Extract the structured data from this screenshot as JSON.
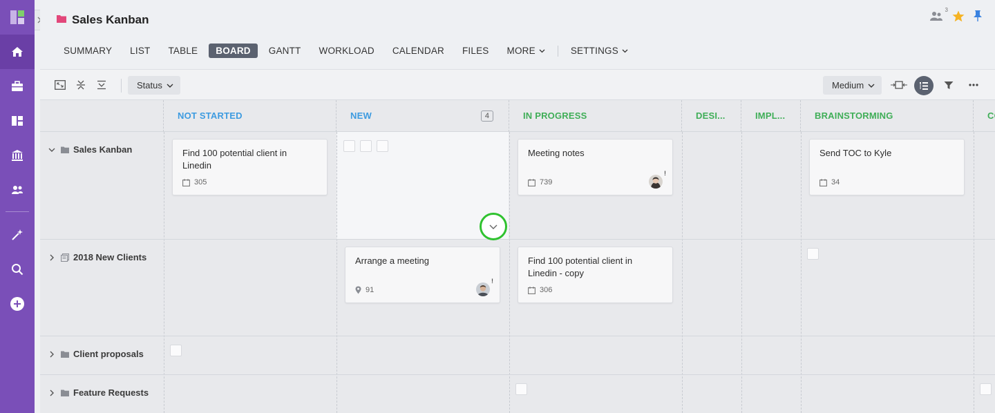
{
  "app": {
    "title": "Sales Kanban",
    "header_icons": [
      "people-icon",
      "star-icon",
      "pin-icon"
    ],
    "member_count": "3",
    "accent": "#7a4fb8",
    "star_color": "#f5b324",
    "pin_color": "#3a82e0"
  },
  "sidebar": {
    "items": [
      "logo-icon",
      "home-icon",
      "briefcase-icon",
      "dashboard-icon",
      "bank-icon",
      "people-icon",
      "magic-wand-icon",
      "search-icon",
      "add-icon"
    ]
  },
  "tabs": [
    {
      "label": "SUMMARY"
    },
    {
      "label": "LIST"
    },
    {
      "label": "TABLE"
    },
    {
      "label": "BOARD",
      "active": true
    },
    {
      "label": "GANTT"
    },
    {
      "label": "WORKLOAD"
    },
    {
      "label": "CALENDAR"
    },
    {
      "label": "FILES"
    },
    {
      "label": "MORE"
    },
    {
      "label": "SETTINGS"
    }
  ],
  "toolbar": {
    "group_by": "Status",
    "card_size": "Medium"
  },
  "columns": [
    {
      "label": "NOT STARTED",
      "color": "#3d9be0"
    },
    {
      "label": "NEW",
      "count": "4",
      "color": "#3d9be0"
    },
    {
      "label": "IN PROGRESS",
      "color": "#3fae57"
    },
    {
      "label": "DESI...",
      "color": "#3fae57"
    },
    {
      "label": "IMPL...",
      "color": "#3fae57"
    },
    {
      "label": "BRAINSTORMING",
      "color": "#3fae57"
    },
    {
      "label": "CO",
      "color": "#3fae57"
    }
  ],
  "rows": [
    {
      "label": "Sales Kanban",
      "icon": "folder-icon"
    },
    {
      "label": "2018 New Clients",
      "icon": "list-icon"
    },
    {
      "label": "Client proposals",
      "icon": "folder-icon"
    },
    {
      "label": "Feature Requests",
      "icon": "folder-icon"
    }
  ],
  "cards": {
    "c1": {
      "title": "Find 100 potential client in Linedin",
      "id": "305",
      "icon": "calendar-icon"
    },
    "c2": {
      "title": "Meeting notes",
      "id": "739",
      "icon": "calendar-icon"
    },
    "c3": {
      "title": "Send TOC to Kyle",
      "id": "34",
      "icon": "calendar-icon"
    },
    "c4": {
      "title": "Arrange a meeting",
      "id": "91",
      "icon": "location-icon"
    },
    "c5": {
      "title": "Find 100 potential client in Linedin - copy",
      "id": "306",
      "icon": "calendar-icon"
    }
  },
  "flag": "!"
}
